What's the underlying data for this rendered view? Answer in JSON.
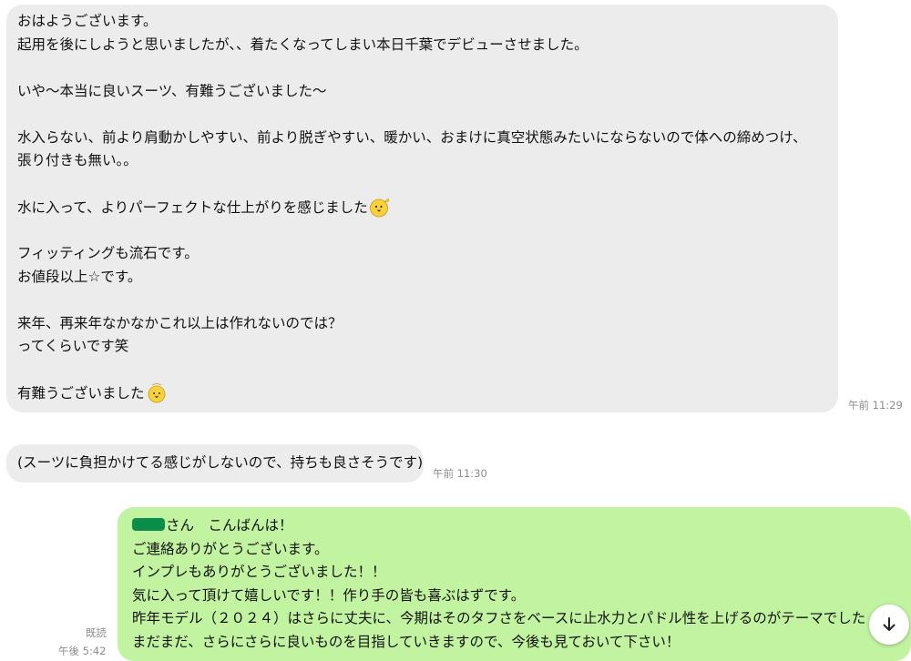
{
  "messages": [
    {
      "lines": [
        "おはようございます。",
        "起用を後にしようと思いましたが、、着たくなってしまい本日千葉でデビューさせました。",
        "",
        "いや〜本当に良いスーツ、有難うございました〜",
        "",
        "水入らない、前より肩動かしやすい、前より脱ぎやすい、暖かい、おまけに真空状態みたいにならないので体への締めつけ、",
        "張り付きも無い。。",
        "",
        "水に入って、よりパーフェクトな仕上がりを感じました",
        "",
        "フィッティングも流石です。",
        "お値段以上☆です。",
        "",
        "来年、再来年なかなかこれ以上は作れないのでは？",
        "ってくらいです笑",
        "",
        "有難うございました"
      ],
      "time": "午前 11:29"
    },
    {
      "text": "(スーツに負担かけてる感じがしないので、持ちも良さそうです)",
      "time": "午前 11:30"
    },
    {
      "greeting": "さん　こんばんは！",
      "lines": [
        "ご連絡ありがとうございます。",
        "インプレもありがとうございました！！",
        "気に入って頂けて嬉しいです！！作り手の皆も喜ぶはずです。",
        "昨年モデル（２０２４）はさらに丈夫に、今期はそのタフさをベースに止水力とパドル性を上げるのがテーマでした",
        "まだまだ、さらにさらに良いものを目指していきますので、今後も見ておいて下さい！"
      ],
      "read_label": "既読",
      "time": "午後 5:42"
    }
  ],
  "icons": {
    "emoji_1": "chick-emoji-icon",
    "emoji_2": "chick-emoji-icon",
    "scroll": "arrow-down-icon"
  },
  "colors": {
    "incoming_bubble": "#ececec",
    "outgoing_bubble": "#c2f3a1",
    "redaction": "#0a8f4a",
    "timestamp": "#8c8c8c"
  }
}
